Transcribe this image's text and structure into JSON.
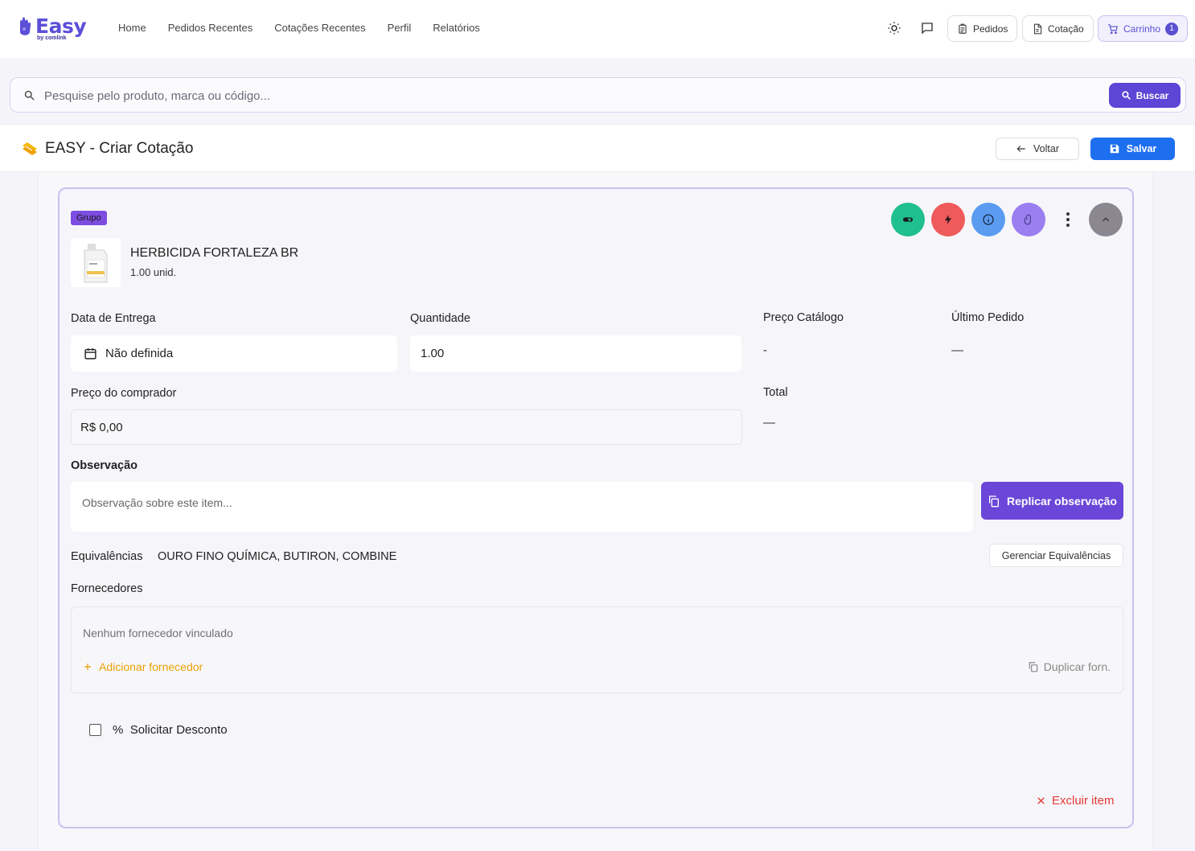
{
  "brand": {
    "name": "Easy",
    "sub": "by comlink"
  },
  "nav": {
    "items": [
      "Home",
      "Pedidos Recentes",
      "Cotações Recentes",
      "Perfil",
      "Relatórios"
    ],
    "pedidos_label": "Pedidos",
    "cotacao_label": "Cotação",
    "carrinho_label": "Carrinho",
    "carrinho_count": "1"
  },
  "search": {
    "placeholder": "Pesquise pelo produto, marca ou código...",
    "button_label": "Buscar"
  },
  "header": {
    "title": "EASY - Criar Cotação",
    "back_label": "Voltar",
    "save_label": "Salvar"
  },
  "item": {
    "group_tag": "Grupo",
    "product_name": "HERBICIDA FORTALEZA BR",
    "product_qty": "1.00 unid.",
    "delivery_label": "Data de Entrega",
    "delivery_value": "Não definida",
    "quantity_label": "Quantidade",
    "quantity_value": "1.00",
    "catalog_price_label": "Preço Catálogo",
    "catalog_price_value": "-",
    "last_order_label": "Último Pedido",
    "last_order_value": "—",
    "buyer_price_label": "Preço do comprador",
    "buyer_price_value": "R$ 0,00",
    "total_label": "Total",
    "total_value": "—",
    "observation_label": "Observação",
    "observation_placeholder": "Observação sobre este item...",
    "replicate_label": "Replicar observação",
    "equivalences_label": "Equivalências",
    "equivalences_value": "OURO FINO QUÍMICA, BUTIRON, COMBINE",
    "manage_equivalences_label": "Gerenciar Equivalências",
    "suppliers_label": "Fornecedores",
    "suppliers_empty": "Nenhum fornecedor vinculado",
    "add_supplier_label": "Adicionar fornecedor",
    "duplicate_supplier_label": "Duplicar forn.",
    "discount_label": "Solicitar Desconto",
    "discount_symbol": "%",
    "delete_label": "Excluir item"
  },
  "colors": {
    "brand": "#5b4fd8",
    "primary": "#1e6ff0",
    "purple": "#6a47d8",
    "green": "#1fbf8f",
    "red": "#ef5a5a",
    "blue": "#5b9cf0",
    "violet": "#9b7ff0",
    "gray": "#8a8791",
    "danger": "#e53935",
    "warning": "#e8a000"
  }
}
